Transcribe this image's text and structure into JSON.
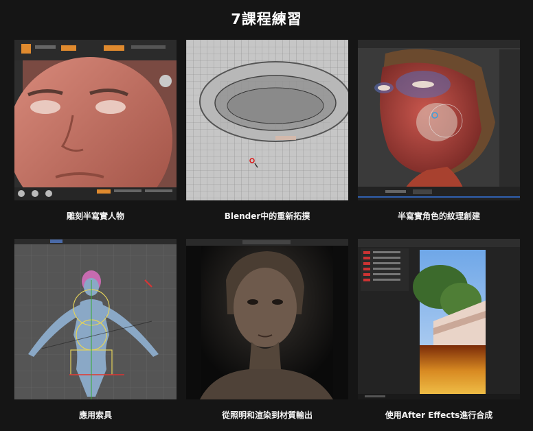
{
  "title": "7課程練習",
  "lessons": [
    {
      "caption": "雕刻半寫實人物"
    },
    {
      "caption": "Blender中的重新拓撲"
    },
    {
      "caption": "半寫實角色的紋理創建"
    },
    {
      "caption": "應用索具"
    },
    {
      "caption": "從照明和渲染到材質輸出"
    },
    {
      "caption": "使用After Effects進行合成"
    }
  ]
}
